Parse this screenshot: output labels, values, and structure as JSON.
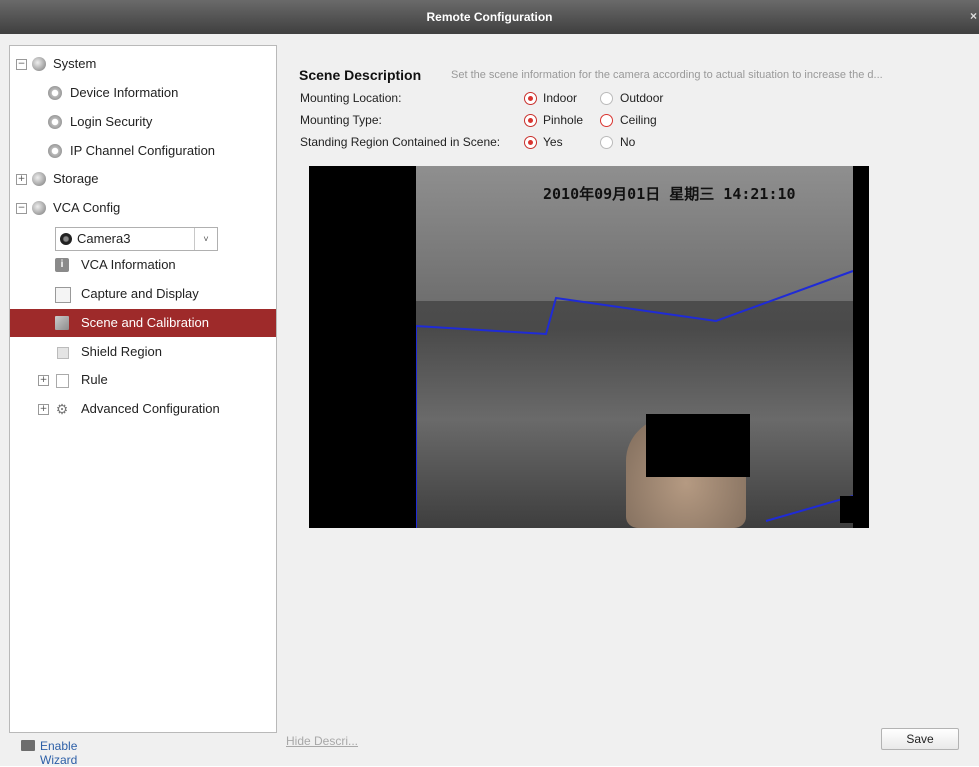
{
  "window": {
    "title": "Remote Configuration",
    "close_glyph": "×"
  },
  "sidebar": {
    "nodes": [
      {
        "label": "System",
        "expander": "−"
      },
      {
        "label": "Device Information"
      },
      {
        "label": "Login Security"
      },
      {
        "label": "IP Channel Configuration"
      },
      {
        "label": "Storage",
        "expander": "+"
      },
      {
        "label": "VCA Config",
        "expander": "−"
      },
      {
        "label": "VCA Information"
      },
      {
        "label": "Capture and Display"
      },
      {
        "label": "Scene and Calibration",
        "selected": true
      },
      {
        "label": "Shield Region"
      },
      {
        "label": "Rule",
        "expander": "+"
      },
      {
        "label": "Advanced Configuration",
        "expander": "+"
      }
    ],
    "camera_select": {
      "value": "Camera3",
      "arrow": "˅"
    },
    "enable_wizard": "Enable Wizard"
  },
  "scene": {
    "title": "Scene Description",
    "description": "Set the scene information for the camera according to actual situation to increase the d...",
    "mounting_location": {
      "label": "Mounting Location:",
      "options": [
        "Indoor",
        "Outdoor"
      ],
      "selected": "Indoor"
    },
    "mounting_type": {
      "label": "Mounting Type:",
      "options": [
        "Pinhole",
        "Ceiling"
      ],
      "selected": "Pinhole"
    },
    "standing_region": {
      "label": "Standing Region Contained in Scene:",
      "options": [
        "Yes",
        "No"
      ],
      "selected": "Yes"
    }
  },
  "video": {
    "osd_text": "2010年09月01日  星期三  14:21:10"
  },
  "footer": {
    "hide_description": "Hide Descri...",
    "save": "Save"
  },
  "colors": {
    "selected_bg": "#9e2a2a",
    "radio_on": "#d9342f",
    "calibration_line": "#1f2bd6"
  }
}
